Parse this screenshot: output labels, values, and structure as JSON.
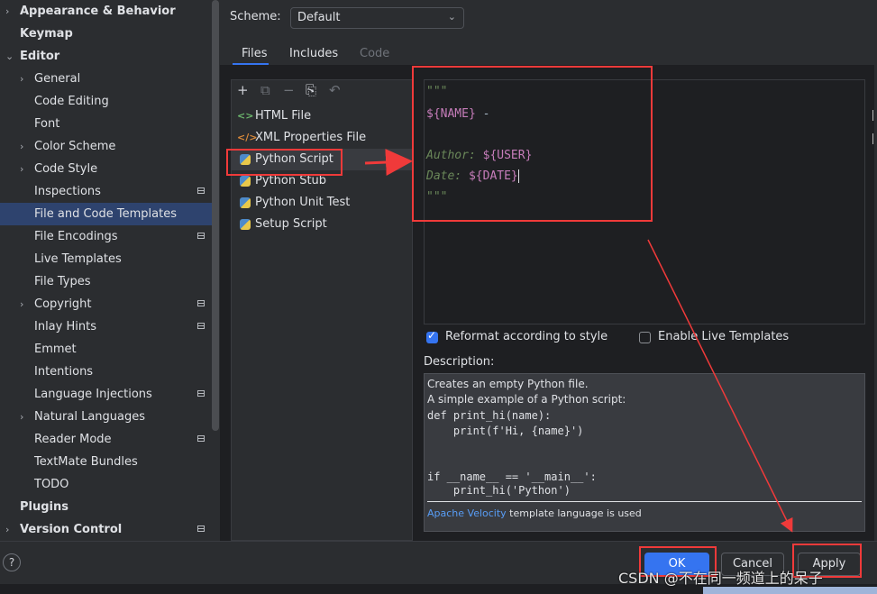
{
  "sidebar": {
    "items": [
      {
        "label": "Appearance & Behavior",
        "chevron": "›",
        "bold": true,
        "indent": 0,
        "badge": false,
        "selected": false
      },
      {
        "label": "Keymap",
        "chevron": "",
        "bold": true,
        "indent": 0,
        "badge": false,
        "selected": false
      },
      {
        "label": "Editor",
        "chevron": "⌄",
        "bold": true,
        "indent": 0,
        "badge": false,
        "selected": false
      },
      {
        "label": "General",
        "chevron": "›",
        "bold": false,
        "indent": 1,
        "badge": false,
        "selected": false
      },
      {
        "label": "Code Editing",
        "chevron": "",
        "bold": false,
        "indent": 1,
        "badge": false,
        "selected": false
      },
      {
        "label": "Font",
        "chevron": "",
        "bold": false,
        "indent": 1,
        "badge": false,
        "selected": false
      },
      {
        "label": "Color Scheme",
        "chevron": "›",
        "bold": false,
        "indent": 1,
        "badge": false,
        "selected": false
      },
      {
        "label": "Code Style",
        "chevron": "›",
        "bold": false,
        "indent": 1,
        "badge": false,
        "selected": false
      },
      {
        "label": "Inspections",
        "chevron": "",
        "bold": false,
        "indent": 1,
        "badge": true,
        "selected": false
      },
      {
        "label": "File and Code Templates",
        "chevron": "",
        "bold": false,
        "indent": 1,
        "badge": false,
        "selected": true
      },
      {
        "label": "File Encodings",
        "chevron": "",
        "bold": false,
        "indent": 1,
        "badge": true,
        "selected": false
      },
      {
        "label": "Live Templates",
        "chevron": "",
        "bold": false,
        "indent": 1,
        "badge": false,
        "selected": false
      },
      {
        "label": "File Types",
        "chevron": "",
        "bold": false,
        "indent": 1,
        "badge": false,
        "selected": false
      },
      {
        "label": "Copyright",
        "chevron": "›",
        "bold": false,
        "indent": 1,
        "badge": true,
        "selected": false
      },
      {
        "label": "Inlay Hints",
        "chevron": "",
        "bold": false,
        "indent": 1,
        "badge": true,
        "selected": false
      },
      {
        "label": "Emmet",
        "chevron": "",
        "bold": false,
        "indent": 1,
        "badge": false,
        "selected": false
      },
      {
        "label": "Intentions",
        "chevron": "",
        "bold": false,
        "indent": 1,
        "badge": false,
        "selected": false
      },
      {
        "label": "Language Injections",
        "chevron": "",
        "bold": false,
        "indent": 1,
        "badge": true,
        "selected": false
      },
      {
        "label": "Natural Languages",
        "chevron": "›",
        "bold": false,
        "indent": 1,
        "badge": false,
        "selected": false
      },
      {
        "label": "Reader Mode",
        "chevron": "",
        "bold": false,
        "indent": 1,
        "badge": true,
        "selected": false
      },
      {
        "label": "TextMate Bundles",
        "chevron": "",
        "bold": false,
        "indent": 1,
        "badge": false,
        "selected": false
      },
      {
        "label": "TODO",
        "chevron": "",
        "bold": false,
        "indent": 1,
        "badge": false,
        "selected": false
      },
      {
        "label": "Plugins",
        "chevron": "",
        "bold": true,
        "indent": 0,
        "badge": false,
        "selected": false
      },
      {
        "label": "Version Control",
        "chevron": "›",
        "bold": true,
        "indent": 0,
        "badge": true,
        "selected": false
      }
    ]
  },
  "scheme": {
    "label": "Scheme:",
    "value": "Default"
  },
  "tabs": [
    {
      "label": "Files",
      "active": true
    },
    {
      "label": "Includes",
      "active": false
    },
    {
      "label": "Code",
      "active": false
    }
  ],
  "toolbar": {
    "add": "+",
    "copy": "⧉",
    "remove": "−",
    "duplicate": "⎘",
    "reset": "↶"
  },
  "templates": [
    {
      "name": "HTML File",
      "icon": "html-icon"
    },
    {
      "name": "XML Properties File",
      "icon": "xml-icon"
    },
    {
      "name": "Python Script",
      "icon": "python-icon"
    },
    {
      "name": "Python Stub",
      "icon": "python-icon"
    },
    {
      "name": "Python Unit Test",
      "icon": "python-icon"
    },
    {
      "name": "Setup Script",
      "icon": "python-icon"
    }
  ],
  "editor": {
    "line1": "\"\"\"",
    "line2_var": "${NAME}",
    "line2_rest": " - ",
    "line4_label": "Author: ",
    "line4_var": "${USER}",
    "line5_label": "Date: ",
    "line5_var": "${DATE}",
    "line6": "\"\"\""
  },
  "options": {
    "reformat": {
      "label": "Reformat according to style",
      "checked": true
    },
    "live": {
      "label": "Enable Live Templates",
      "checked": false
    }
  },
  "description": {
    "label": "Description:",
    "line1": "Creates an empty Python file.",
    "line2": "A simple example of a Python script:",
    "code1": "def print_hi(name):",
    "code2": "    print(f'Hi, {name}')",
    "code3": "if __name__ == '__main__':",
    "code4": "    print_hi('Python')",
    "footer_link": "Apache Velocity",
    "footer_rest": " template language is used"
  },
  "buttons": {
    "ok": "OK",
    "cancel": "Cancel",
    "apply": "Apply",
    "help": "?"
  },
  "watermark": "CSDN @不在同一频道上的呆子",
  "colors": {
    "accent": "#3574f0",
    "selection": "#2e436e",
    "annotation": "#f03a3a"
  }
}
